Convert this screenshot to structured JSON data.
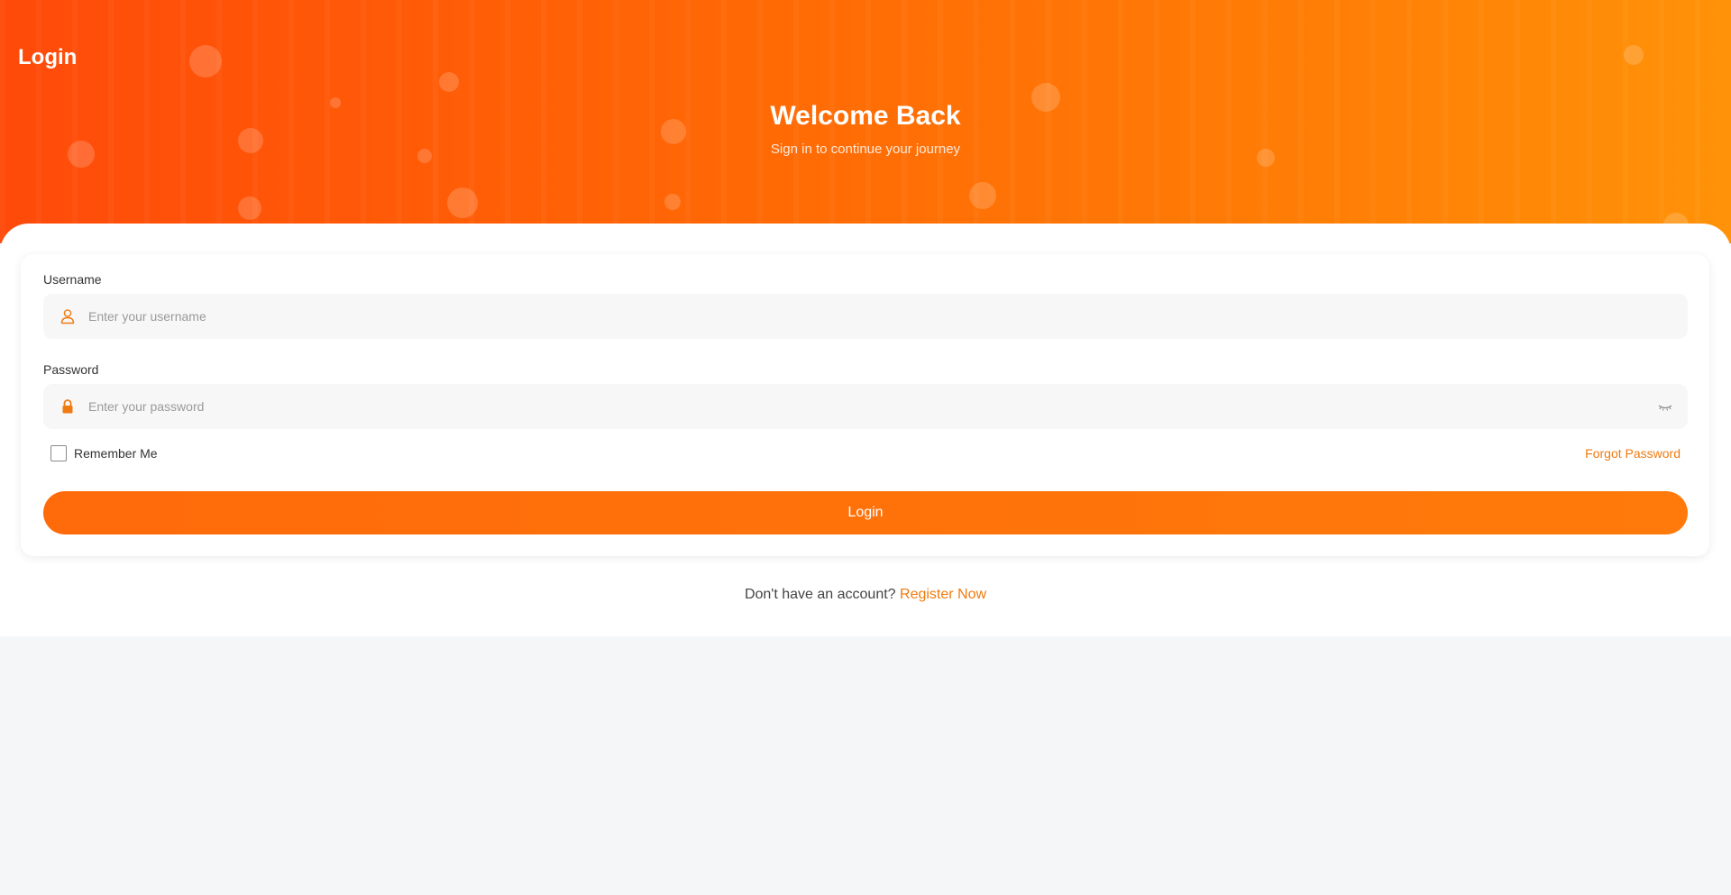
{
  "header": {
    "page_title": "Login",
    "welcome": "Welcome Back",
    "subtitle": "Sign in to continue your journey"
  },
  "form": {
    "username": {
      "label": "Username",
      "placeholder": "Enter your username",
      "value": "",
      "icon": "user-icon"
    },
    "password": {
      "label": "Password",
      "placeholder": "Enter your password",
      "value": "",
      "icon": "lock-icon",
      "toggle_icon": "eye-closed-icon"
    },
    "remember_label": "Remember Me",
    "remember_checked": false,
    "forgot_label": "Forgot Password",
    "submit_label": "Login"
  },
  "footer": {
    "prompt": "Don't have an account?",
    "register_label": "Register Now"
  },
  "colors": {
    "accent": "#ff6a0a",
    "link": "#f07a10",
    "hero_start": "#ff4a0a",
    "hero_end": "#ff9208"
  }
}
